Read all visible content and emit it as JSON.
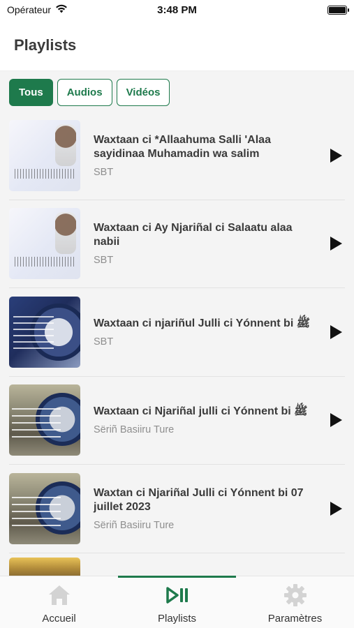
{
  "status_bar": {
    "carrier": "Opérateur",
    "time": "3:48 PM",
    "battery_level": 1.0
  },
  "header": {
    "title": "Playlists"
  },
  "filters": [
    {
      "label": "Tous",
      "active": true
    },
    {
      "label": "Audios",
      "active": false
    },
    {
      "label": "Vidéos",
      "active": false
    }
  ],
  "items": [
    {
      "title": "Waxtaan ci *Allaahuma Salli 'Alaa sayidinaa Muhamadin wa salim",
      "subtitle": "SBT",
      "thumb_icon": "audio-thumbnail"
    },
    {
      "title": "Waxtaan ci Ay Njariñal ci Salaatu alaa nabii",
      "subtitle": "SBT",
      "thumb_icon": "audio-thumbnail"
    },
    {
      "title": "Waxtaan ci njariñul Julli ci Yónnent bi ﷺ",
      "subtitle": "SBT",
      "thumb_icon": "video-thumbnail"
    },
    {
      "title": "Waxtaan ci Njariñal julli ci Yónnent bi ﷺ",
      "subtitle": "Sëriñ Basiiru Ture",
      "thumb_icon": "video-thumbnail"
    },
    {
      "title": "Waxtan ci Njariñal Julli ci Yónnent bi 07 juillet 2023",
      "subtitle": "Sëriñ Basiiru Ture",
      "thumb_icon": "video-thumbnail"
    }
  ],
  "tabbar": [
    {
      "label": "Accueil",
      "icon": "home-icon",
      "active": false
    },
    {
      "label": "Playlists",
      "icon": "playlist-play-icon",
      "active": true
    },
    {
      "label": "Paramètres",
      "icon": "gear-icon",
      "active": false
    }
  ],
  "colors": {
    "accent": "#1e7a4c",
    "inactive_icon": "#d3d3d3"
  }
}
